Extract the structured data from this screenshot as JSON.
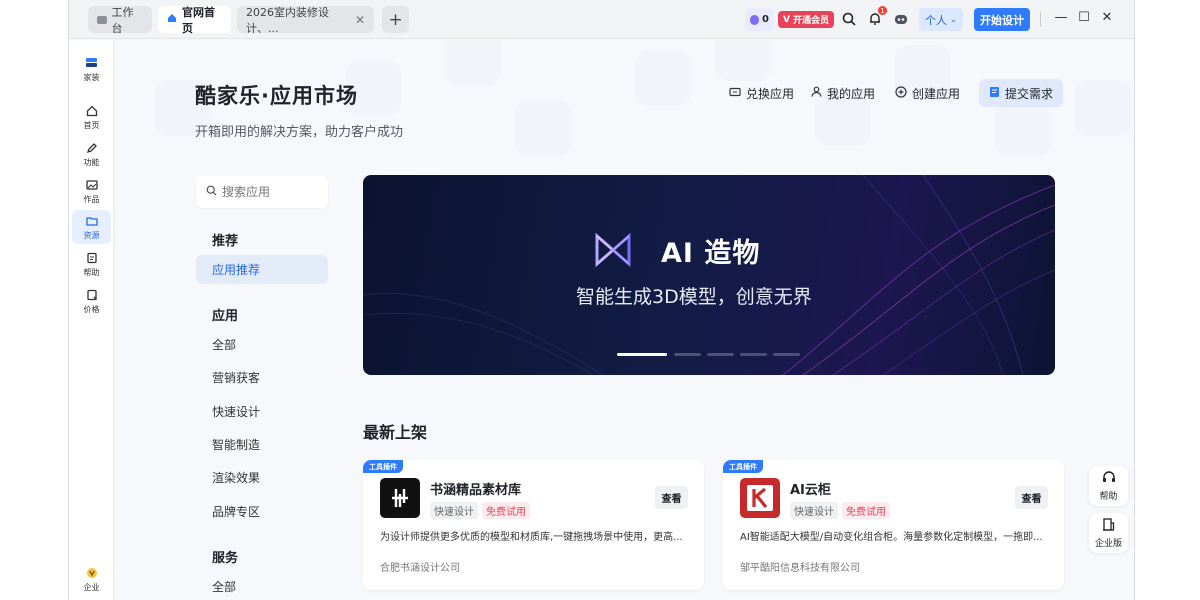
{
  "tabs": [
    {
      "label": "工作台"
    },
    {
      "label": "官网首页"
    },
    {
      "label": "2026室内装修设计、..."
    }
  ],
  "titlebar": {
    "points_value": "0",
    "vip_label": "开通会员",
    "notification_count": "1",
    "personal_label": "个人",
    "start_design_label": "开始设计"
  },
  "sidebar": {
    "brand_label": "家装",
    "items": [
      {
        "label": "首页"
      },
      {
        "label": "功能"
      },
      {
        "label": "作品"
      },
      {
        "label": "资源"
      },
      {
        "label": "帮助"
      },
      {
        "label": "价格"
      }
    ],
    "bottom_label": "企业"
  },
  "header": {
    "title": "酷家乐·应用市场",
    "subtitle": "开箱即用的解决方案，助力客户成功",
    "actions": {
      "redeem": "兑换应用",
      "my_apps": "我的应用",
      "create": "创建应用",
      "submit": "提交需求"
    }
  },
  "search": {
    "placeholder": "搜索应用"
  },
  "nav": {
    "recommend_heading": "推荐",
    "recommend_item": "应用推荐",
    "apps_heading": "应用",
    "apps_items": [
      "全部",
      "营销获客",
      "快速设计",
      "智能制造",
      "渲染效果",
      "品牌专区"
    ],
    "service_heading": "服务",
    "service_items": [
      "全部"
    ]
  },
  "banner": {
    "title": "AI 造物",
    "subtitle": "智能生成3D模型，创意无界"
  },
  "section_title": "最新上架",
  "cards": [
    {
      "tag": "工具插件",
      "name": "书涵精品素材库",
      "chips": [
        "快速设计",
        "免费试用"
      ],
      "view": "查看",
      "desc": "为设计师提供更多优质的模型和材质库,一键拖拽场景中使用，更高...",
      "company": "合肥书涵设计公司"
    },
    {
      "tag": "工具插件",
      "name": "AI云柜",
      "chips": [
        "快速设计",
        "免费试用"
      ],
      "view": "查看",
      "desc": "AI智能适配大模型/自动变化组合柜。海量参数化定制模型，一拖即...",
      "company": "邹平酷阳信息科技有限公司"
    }
  ],
  "float": {
    "help_label": "帮助",
    "enterprise_label": "企业版"
  },
  "colors": {
    "accent": "#2f7bff",
    "vip": "#e9435a",
    "banner_bg": "#121c45"
  }
}
